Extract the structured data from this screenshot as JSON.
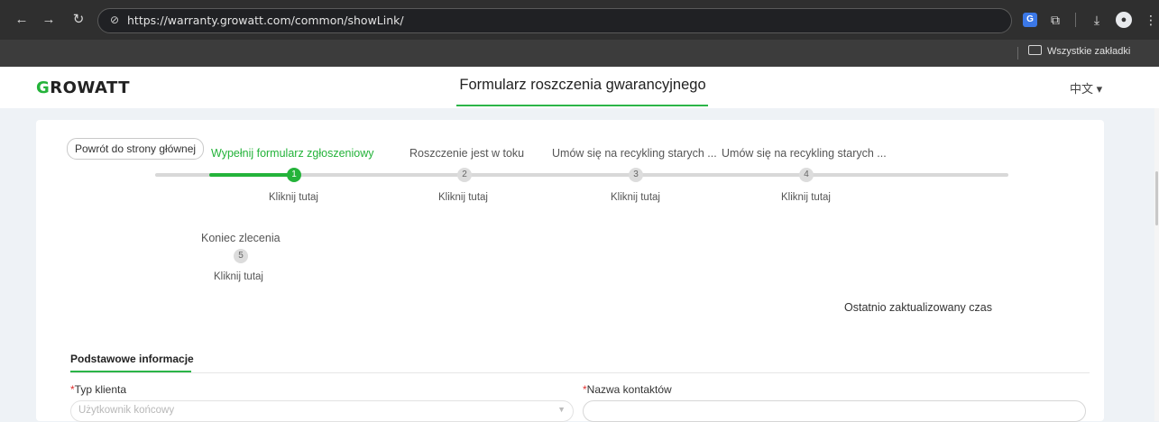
{
  "browser": {
    "url": "https://warranty.growatt.com/common/showLink/",
    "bookmarks_label": "Wszystkie zakładki",
    "icons": [
      "back-arrow-icon",
      "forward-arrow-icon",
      "reload-icon",
      "site-info-icon",
      "translate-icon",
      "extensions-icon",
      "download-icon",
      "profile-icon",
      "menu-icon",
      "folder-icon"
    ]
  },
  "header": {
    "logo_initial": "G",
    "logo_rest": "ROWATT",
    "title": "Formularz roszczenia gwarancyjnego",
    "language": "中文 ▾"
  },
  "main": {
    "back_button": "Powrót do strony głównej",
    "steps": [
      {
        "title": "Wypełnij formularz zgłoszeniowy",
        "number": "1",
        "link": "Kliknij tutaj",
        "active": true
      },
      {
        "title": "Roszczenie jest w toku",
        "number": "2",
        "link": "Kliknij tutaj",
        "active": false
      },
      {
        "title": "Umów się na recykling starych ...",
        "number": "3",
        "link": "Kliknij tutaj",
        "active": false
      },
      {
        "title": "Umów się na recykling starych ...",
        "number": "4",
        "link": "Kliknij tutaj",
        "active": false
      },
      {
        "title": "Koniec zlecenia",
        "number": "5",
        "link": "Kliknij tutaj",
        "active": false
      }
    ],
    "last_updated_label": "Ostatnio zaktualizowany czas",
    "section_tab": "Podstawowe informacje",
    "fields": {
      "customer_type": {
        "required_mark": "*",
        "label": "Typ klienta",
        "placeholder": "Użytkownik końcowy"
      },
      "contact_name": {
        "required_mark": "*",
        "label": "Nazwa kontaktów",
        "value": ""
      }
    }
  },
  "colors": {
    "accent": "#24b33a",
    "required": "#e0302e",
    "chrome": "#3c3c3c"
  }
}
